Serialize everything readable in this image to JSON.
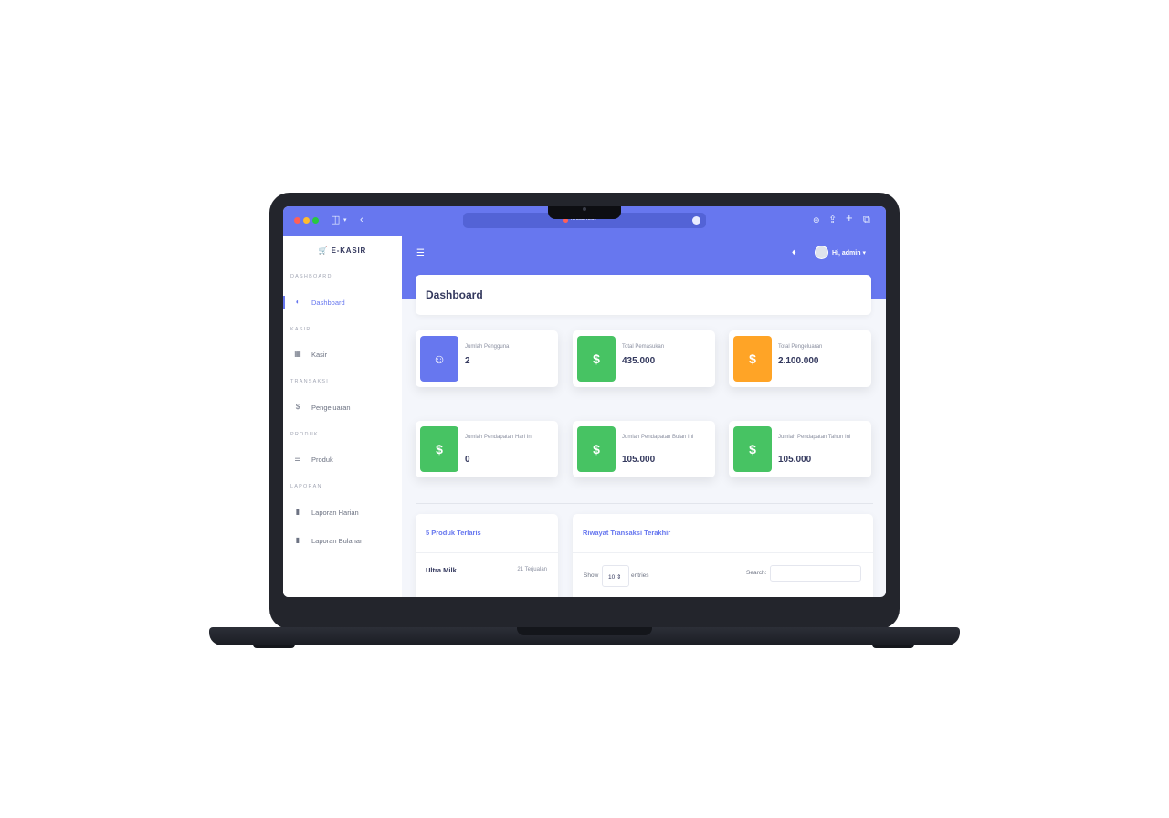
{
  "browser": {
    "url": "localhost"
  },
  "sidebar": {
    "brand": "E-KASIR",
    "sections": [
      {
        "header": "DASHBOARD",
        "items": [
          {
            "label": "Dashboard",
            "icon": "dashboard-icon"
          }
        ]
      },
      {
        "header": "KASIR",
        "items": [
          {
            "label": "Kasir",
            "icon": "register-icon"
          }
        ]
      },
      {
        "header": "TRANSAKSI",
        "items": [
          {
            "label": "Pengeluaran",
            "icon": "dollar-icon"
          }
        ]
      },
      {
        "header": "PRODUK",
        "items": [
          {
            "label": "Produk",
            "icon": "list-icon"
          }
        ]
      },
      {
        "header": "LAPORAN",
        "items": [
          {
            "label": "Laporan Harian",
            "icon": "file-icon"
          },
          {
            "label": "Laporan Bulanan",
            "icon": "file-icon"
          }
        ]
      }
    ]
  },
  "navbar": {
    "greeting": "Hi, admin"
  },
  "page": {
    "title": "Dashboard"
  },
  "stats": [
    {
      "label": "Jumlah Pengguna",
      "value": "2",
      "icon": "user-icon",
      "color": "#6777ef"
    },
    {
      "label": "Total Pemasukan",
      "value": "435.000",
      "icon": "dollar-icon",
      "color": "#47c363"
    },
    {
      "label": "Total Pengeluaran",
      "value": "2.100.000",
      "icon": "dollar-icon",
      "color": "#ffa426"
    },
    {
      "label": "Jumlah Pendapatan Hari Ini",
      "value": "0",
      "icon": "dollar-icon",
      "color": "#47c363"
    },
    {
      "label": "Jumlah Pendapatan Bulan Ini",
      "value": "105.000",
      "icon": "dollar-icon",
      "color": "#47c363"
    },
    {
      "label": "Jumlah Pendapatan Tahun Ini",
      "value": "105.000",
      "icon": "dollar-icon",
      "color": "#47c363"
    }
  ],
  "top_products": {
    "title": "5 Produk Terlaris",
    "rows": [
      {
        "name": "Ultra Milk",
        "meta": "21 Terjualan"
      }
    ]
  },
  "transactions": {
    "title": "Riwayat Transaksi Terakhir",
    "show_label": "Show",
    "entries_value": "10",
    "entries_label": "entries",
    "search_label": "Search:"
  },
  "colors": {
    "primary": "#6777ef",
    "success": "#47c363",
    "warning": "#ffa426"
  }
}
